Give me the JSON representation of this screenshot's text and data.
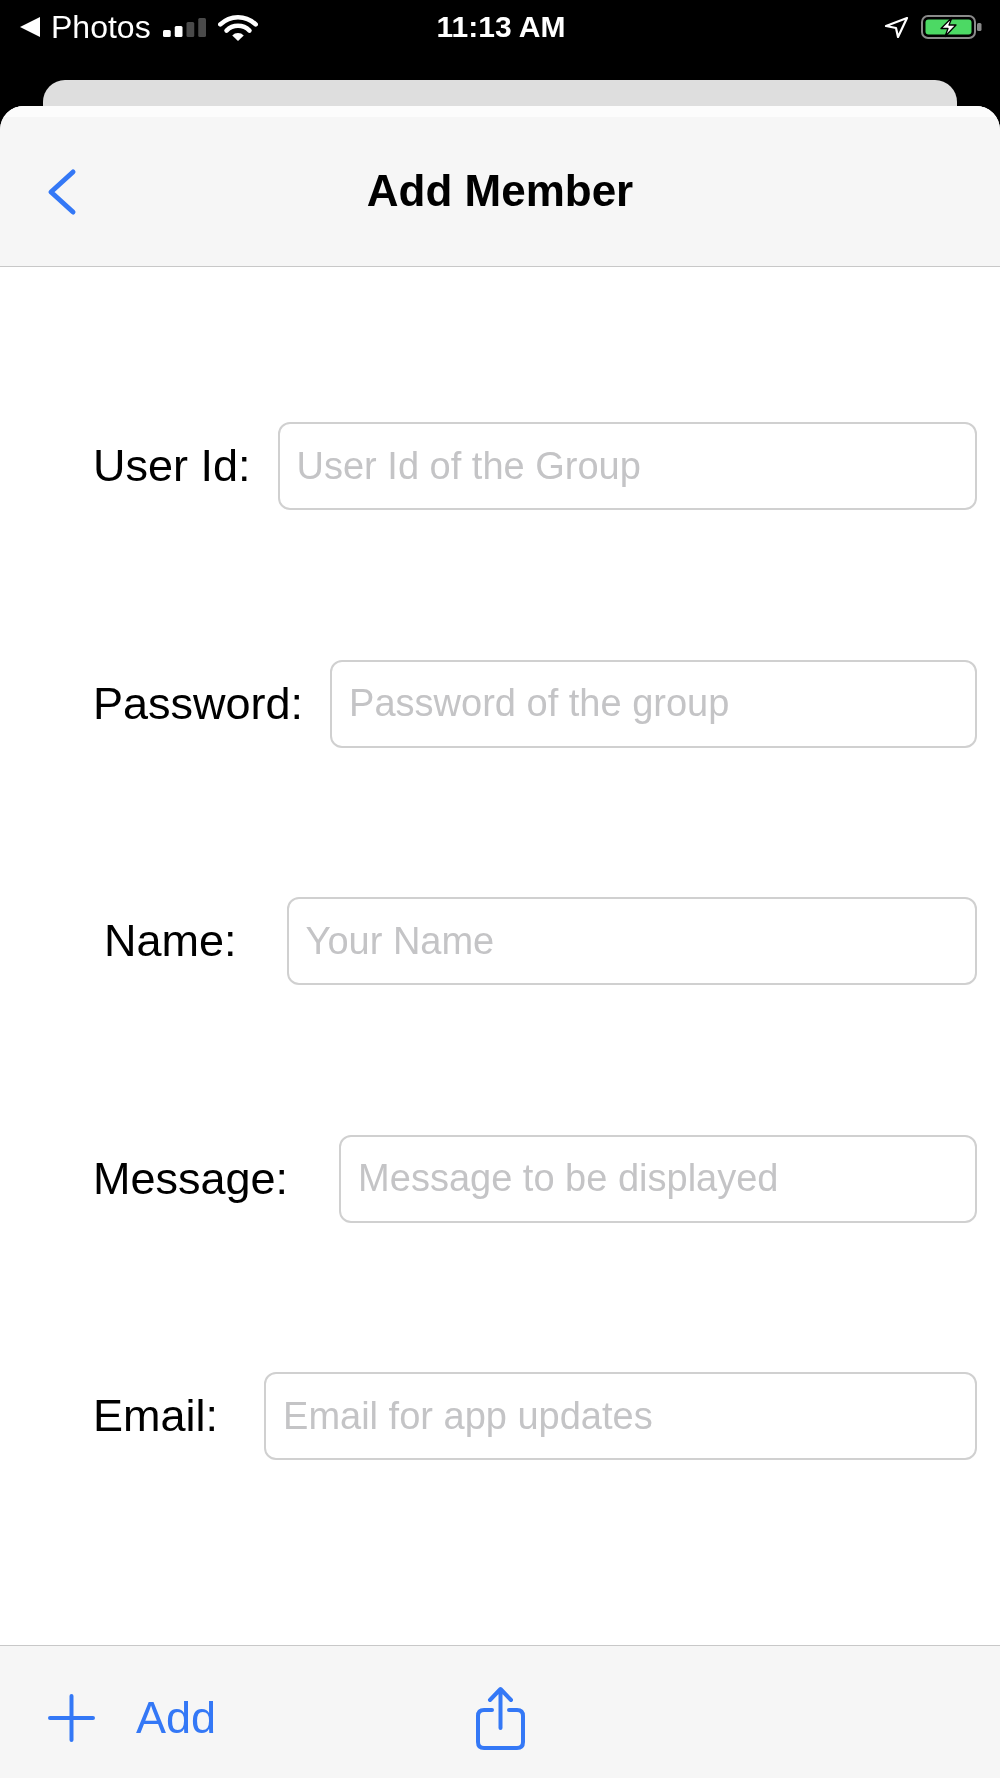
{
  "status_bar": {
    "back_label": "Photos",
    "time": "11:13 AM"
  },
  "nav_bar": {
    "title": "Add Member"
  },
  "form": {
    "fields": [
      {
        "label": "User Id:",
        "placeholder": "User Id of the Group"
      },
      {
        "label": "Password:",
        "placeholder": "Password of the group"
      },
      {
        "label": "Name:",
        "placeholder": "Your Name"
      },
      {
        "label": "Message:",
        "placeholder": "Message to be displayed"
      },
      {
        "label": "Email:",
        "placeholder": "Email for app updates"
      }
    ]
  },
  "toolbar": {
    "add_label": "Add"
  }
}
